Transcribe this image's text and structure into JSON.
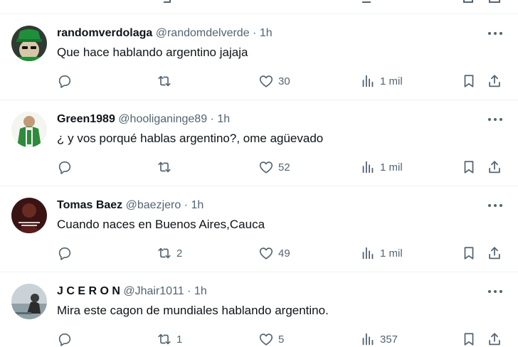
{
  "colors": {
    "text": "#0f1419",
    "muted": "#536471",
    "divider": "#eff3f4"
  },
  "tweets": [
    {
      "name": "randomverdolaga",
      "handle": "@randomdelverde",
      "dot": "·",
      "time": "1h",
      "text": "Que hace hablando argentino jajaja",
      "replies": "",
      "retweets": "",
      "likes": "30",
      "views": "1 mil",
      "avatar_icon": "avatar-green-hat"
    },
    {
      "name": "Green1989",
      "handle": "@hooliganinge89",
      "dot": "·",
      "time": "1h",
      "text": "¿ y vos porqué hablas argentino?, ome agüevado",
      "replies": "",
      "retweets": "",
      "likes": "52",
      "views": "1 mil",
      "avatar_icon": "avatar-green-jersey"
    },
    {
      "name": "Tomas Baez",
      "handle": "@baezjero",
      "dot": "·",
      "time": "1h",
      "text": "Cuando naces en Buenos Aires,Cauca",
      "replies": "",
      "retweets": "2",
      "likes": "49",
      "views": "1 mil",
      "avatar_icon": "avatar-dark-red"
    },
    {
      "name": "J C E R O N",
      "handle": "@Jhair1011",
      "dot": "·",
      "time": "1h",
      "text": "Mira este cagon de mundiales hablando argentino.",
      "replies": "",
      "retweets": "1",
      "likes": "5",
      "views": "357",
      "avatar_icon": "avatar-water-photo"
    }
  ]
}
